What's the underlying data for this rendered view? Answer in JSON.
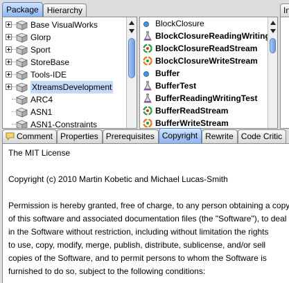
{
  "top_tabs": {
    "left": [
      {
        "label": "Package",
        "selected": true
      },
      {
        "label": "Hierarchy",
        "selected": false
      }
    ],
    "right_partial": "In"
  },
  "packages": [
    {
      "label": "Base VisualWorks",
      "expandable": true,
      "selected": false
    },
    {
      "label": "Glorp",
      "expandable": true,
      "selected": false
    },
    {
      "label": "Sport",
      "expandable": true,
      "selected": false
    },
    {
      "label": "StoreBase",
      "expandable": true,
      "selected": false
    },
    {
      "label": "Tools-IDE",
      "expandable": true,
      "selected": false
    },
    {
      "label": "XtreamsDevelopment",
      "expandable": true,
      "selected": true
    },
    {
      "label": "ARC4",
      "expandable": false,
      "selected": false
    },
    {
      "label": "ASN1",
      "expandable": false,
      "selected": false
    },
    {
      "label": "ASN1-Constraints",
      "expandable": false,
      "selected": false
    }
  ],
  "classes": [
    {
      "label": "BlockClosure",
      "bold": false,
      "icon": "extension-dot-icon"
    },
    {
      "label": "BlockClosureReadingWriting",
      "bold": true,
      "icon": "test-flask-icon"
    },
    {
      "label": "BlockClosureReadStream",
      "bold": true,
      "icon": "read-stream-icon"
    },
    {
      "label": "BlockClosureWriteStream",
      "bold": true,
      "icon": "write-stream-icon"
    },
    {
      "label": "Buffer",
      "bold": true,
      "icon": "class-dot-icon"
    },
    {
      "label": "BufferTest",
      "bold": true,
      "icon": "test-flask-icon"
    },
    {
      "label": "BufferReadingWritingTest",
      "bold": true,
      "icon": "test-flask-icon"
    },
    {
      "label": "BufferReadStream",
      "bold": true,
      "icon": "read-stream-icon"
    },
    {
      "label": "BufferWriteStream",
      "bold": true,
      "icon": "write-stream-icon"
    }
  ],
  "bottom_tabs": [
    {
      "label": "Comment",
      "selected": false,
      "icon": "comment-icon"
    },
    {
      "label": "Properties",
      "selected": false,
      "icon": ""
    },
    {
      "label": "Prerequisites",
      "selected": false,
      "icon": ""
    },
    {
      "label": "Copyright",
      "selected": true,
      "icon": ""
    },
    {
      "label": "Rewrite",
      "selected": false,
      "icon": ""
    },
    {
      "label": "Code Critic",
      "selected": false,
      "icon": ""
    }
  ],
  "copyright_text": [
    "The MIT License",
    "",
    "Copyright (c) 2010 Martin Kobetic and Michael Lucas-Smith",
    "",
    "Permission is hereby granted, free of charge, to any person obtaining a copy",
    "of this software and associated documentation files (the \"Software\"), to deal",
    "in the Software without restriction, including without limitation the rights",
    "to use, copy, modify, merge, publish, distribute, sublicense, and/or sell",
    "copies of the Software, and to permit persons to whom the Software is",
    "furnished to do so, subject to the following conditions:"
  ],
  "colors": {
    "selection": "#c3d9f7",
    "tab_selected": "#8bb4f0",
    "test_icon": "#8a4fb0",
    "stream_icon": "#2e9b3a",
    "write_stream_icon": "#e07a1a",
    "class_dot": "#4a90d9"
  }
}
